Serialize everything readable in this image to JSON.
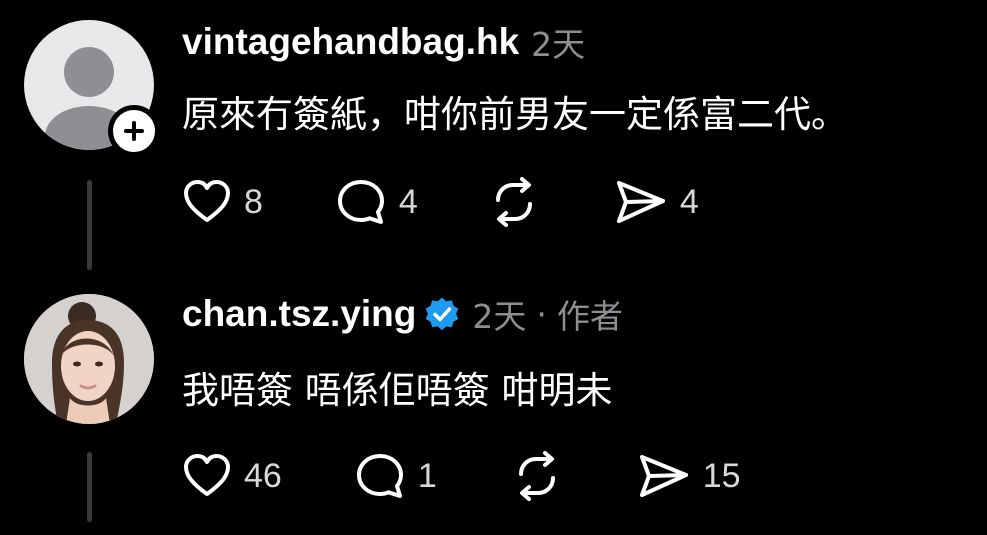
{
  "comments": [
    {
      "username": "vintagehandbag.hk",
      "time": "2天",
      "text": "原來冇簽紙，咁你前男友一定係富二代。",
      "actions": {
        "likes": "8",
        "replies": "4",
        "shares": "4"
      }
    },
    {
      "username": "chan.tsz.ying",
      "time": "2天",
      "separator": "·",
      "role": "作者",
      "text": "我唔簽 唔係佢唔簽 咁明未",
      "actions": {
        "likes": "46",
        "replies": "1",
        "shares": "15"
      }
    }
  ],
  "colors": {
    "background": "#000000",
    "text": "#ffffff",
    "muted": "#8e8e93",
    "verified": "#1d9bf0"
  },
  "icons": [
    "heart-icon",
    "comment-icon",
    "repost-icon",
    "send-icon",
    "plus-icon",
    "verified-icon"
  ]
}
